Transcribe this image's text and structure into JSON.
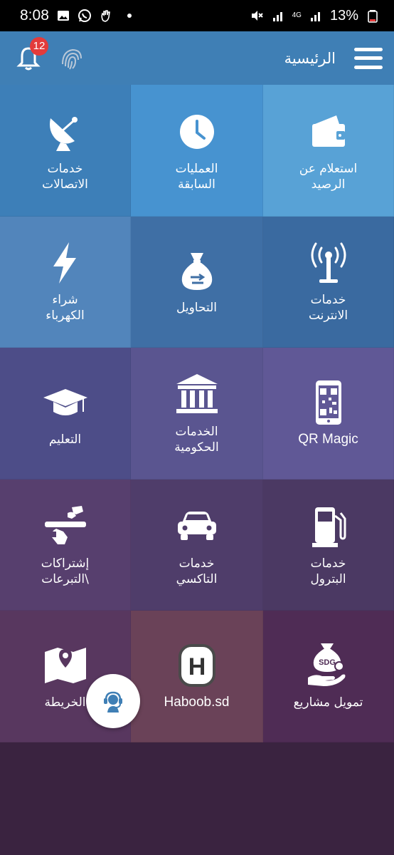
{
  "status_bar": {
    "time": "8:08",
    "battery": "13%",
    "network": "4G"
  },
  "app_bar": {
    "title": "الرئيسية",
    "notification_count": "12"
  },
  "tiles": [
    {
      "label": "خدمات\nالاتصالات",
      "icon": "satellite-dish-icon",
      "bg": "#3d7fb8"
    },
    {
      "label": "العمليات\nالسابقة",
      "icon": "clock-icon",
      "bg": "#4793d0"
    },
    {
      "label": "استعلام عن\nالرصيد",
      "icon": "wallet-icon",
      "bg": "#58a2d6"
    },
    {
      "label": "شراء\nالكهرباء",
      "icon": "lightning-icon",
      "bg": "#5285bb"
    },
    {
      "label": "التحاويل",
      "icon": "money-bag-icon",
      "bg": "#3f6fa5"
    },
    {
      "label": "خدمات\nالانترنت",
      "icon": "antenna-icon",
      "bg": "#3a6aa0"
    },
    {
      "label": "التعليم",
      "icon": "graduation-cap-icon",
      "bg": "#4d4d88"
    },
    {
      "label": "الخدمات\nالحكومية",
      "icon": "government-building-icon",
      "bg": "#5a5590"
    },
    {
      "label": "QR Magic",
      "icon": "qr-phone-icon",
      "bg": "#605896"
    },
    {
      "label": "إشتراكات\nالتبرعات\\",
      "icon": "donation-hand-icon",
      "bg": "#573f6e"
    },
    {
      "label": "خدمات\nالتاكسي",
      "icon": "car-icon",
      "bg": "#4f3d6a"
    },
    {
      "label": "خدمات\nالبترول",
      "icon": "fuel-pump-icon",
      "bg": "#4b3963"
    },
    {
      "label": "الخريطة",
      "icon": "map-icon",
      "bg": "#58375f"
    },
    {
      "label": "Haboob.sd",
      "icon": "haboob-h-icon",
      "bg": "#6a4258"
    },
    {
      "label": "تمويل مشاريع",
      "icon": "sdg-funding-icon",
      "bg": "#4f2c55"
    }
  ],
  "icon_labels": {
    "sdg": "SDG",
    "haboob": "H"
  },
  "colors": {
    "app_bar": "#3f7fb5",
    "background": "#3a2340",
    "badge": "#e33b3b"
  }
}
